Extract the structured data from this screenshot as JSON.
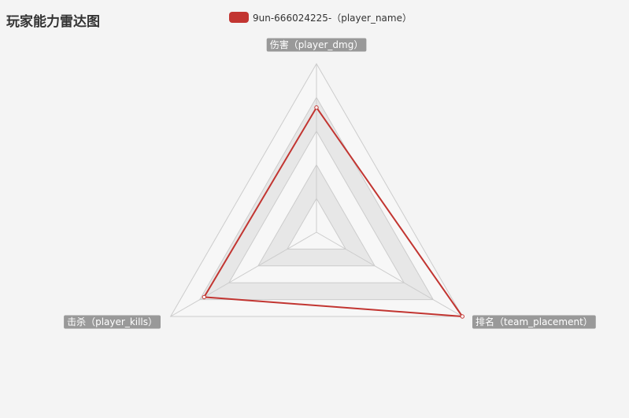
{
  "chart_data": {
    "type": "radar",
    "title": "玩家能力雷达图",
    "indicators": [
      {
        "name": "伤害（player_dmg）",
        "max": 100
      },
      {
        "name": "排名（team_placement）",
        "max": 100
      },
      {
        "name": "击杀（player_kills）",
        "max": 100
      }
    ],
    "series": [
      {
        "name": "9un-666024225-（player_name）",
        "values": [
          74,
          100,
          77
        ],
        "color": "#c23531"
      }
    ],
    "split_number": 5,
    "legend_position": "top-center"
  }
}
